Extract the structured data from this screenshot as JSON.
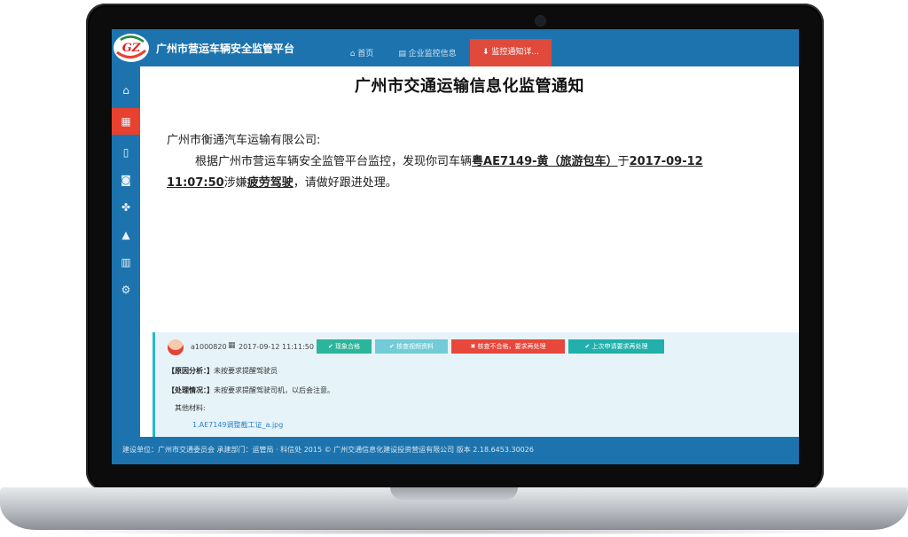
{
  "header": {
    "app_title": "广州市营运车辆安全监管平台",
    "logo_text": "GZ",
    "tabs": [
      {
        "label": "⌂ 首页"
      },
      {
        "label": "▤ 企业监控信息"
      },
      {
        "label": "⬇ 监控通知详..."
      }
    ]
  },
  "sidebar": {
    "items": [
      {
        "name": "home",
        "icon": "⌂"
      },
      {
        "name": "calendar",
        "icon": "▦"
      },
      {
        "name": "document",
        "icon": "▯"
      },
      {
        "name": "camera",
        "icon": "◙"
      },
      {
        "name": "network",
        "icon": "✤"
      },
      {
        "name": "warning",
        "icon": "▲"
      },
      {
        "name": "chart",
        "icon": "▥"
      },
      {
        "name": "settings",
        "icon": "⚙"
      }
    ],
    "active_index": 1
  },
  "notice": {
    "title": "广州市交通运输信息化监管通知",
    "addressee": "广州市衡通汽车运输有限公司:",
    "body_prefix": "根据广州市营运车辆安全监管平台监控，发现你司车辆",
    "vehicle": "粤AE7149-黄（旅游包车）",
    "body_mid": "于",
    "date_part1": "2017-09-12",
    "date_part2": "11:07:50",
    "body_mid2": "涉嫌",
    "violation": "疲劳驾驶",
    "body_suffix": "，请做好跟进处理。"
  },
  "reply": {
    "user": "a1000820",
    "timestamp": "2017-09-12 11:11:50",
    "buttons": [
      "✔ 现象合格",
      "✔ 核查视频资料",
      "✖ 核查不合格，要求再处理",
      "✔ 上次申请要求再处理"
    ],
    "line1_label": "【原因分析：】",
    "line1_text": "未按要求提醒驾驶员",
    "line2_label": "【处理情况：】",
    "line2_text": "未按要求提醒驾驶司机，以后会注意。",
    "other_label": "其他材料:",
    "attachment": "1.AE7149调整截工证_a.jpg"
  },
  "footer": {
    "text": "建设单位：广州市交通委员会  承建部门：运管局 · 科信处  2015 © 广州交通信息化建设投资营运有限公司 版本 2.18.6453.30026"
  },
  "colors": {
    "brand_blue": "#1d73ad",
    "active_red": "#e8412f",
    "reply_bg": "#e6f4fa",
    "accent_teal": "#27b5cf"
  }
}
